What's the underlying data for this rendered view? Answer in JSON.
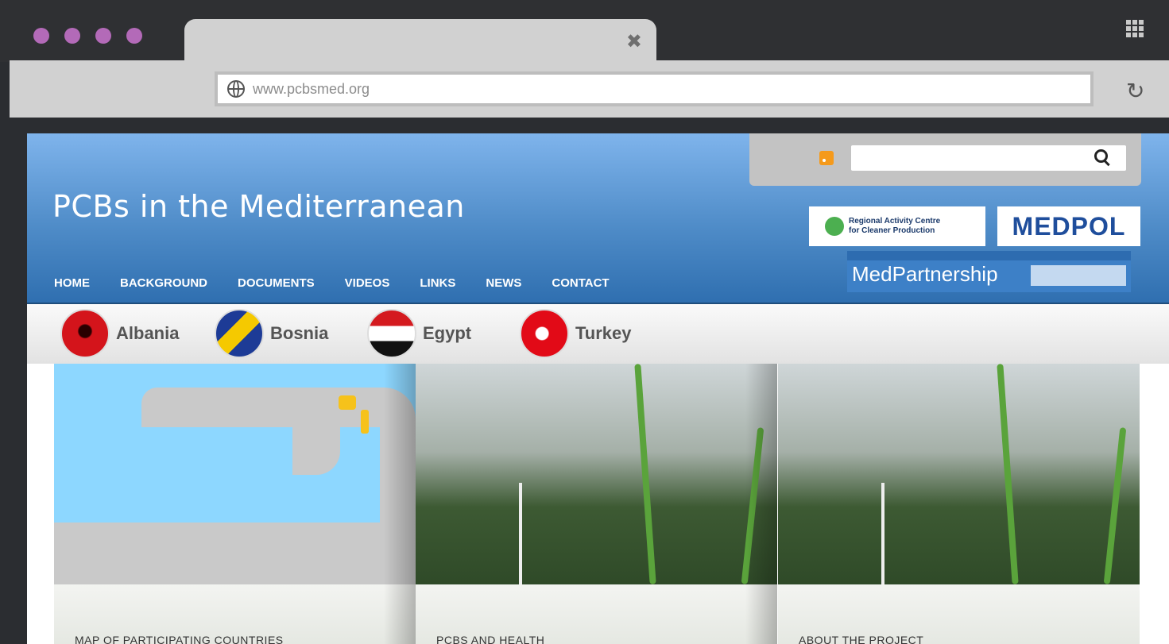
{
  "browser": {
    "url": "www.pcbsmed.org"
  },
  "site": {
    "title": "PCBs in the Mediterranean",
    "nav": [
      "HOME",
      "BACKGROUND",
      "DOCUMENTS",
      "VIDEOS",
      "LINKS",
      "NEWS",
      "CONTACT"
    ],
    "logos": {
      "rac_line1": "Regional Activity Centre",
      "rac_line2": "for Cleaner Production",
      "medpol": "MEDPOL",
      "medpartnership": "MedPartnership"
    },
    "countries": [
      "Albania",
      "Bosnia",
      "Egypt",
      "Turkey"
    ],
    "cards": [
      "MAP OF PARTICIPATING COUNTRIES",
      "PCBS AND HEALTH",
      "ABOUT THE PROJECT"
    ]
  },
  "colors": {
    "browser_dot": "#b36ab8",
    "header_blue": "#4f8cc8"
  }
}
